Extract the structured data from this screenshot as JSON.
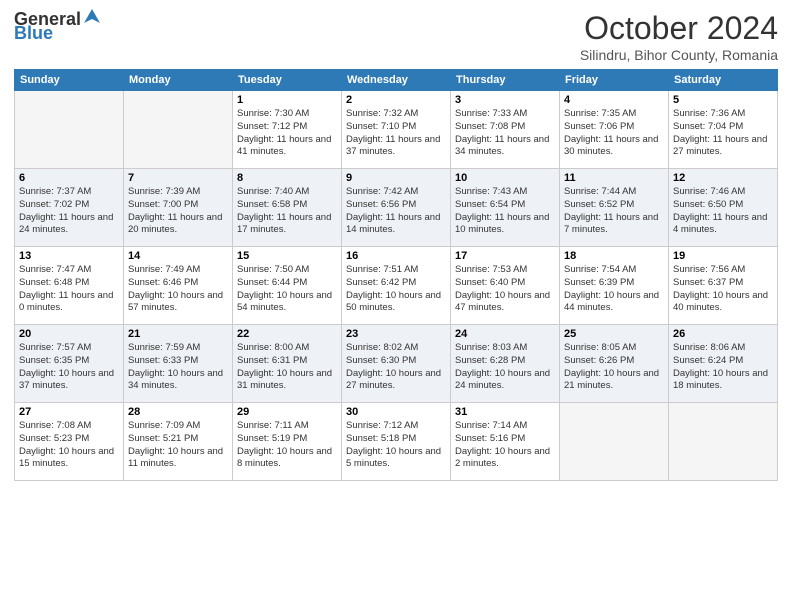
{
  "header": {
    "logo_general": "General",
    "logo_blue": "Blue",
    "month_title": "October 2024",
    "location": "Silindru, Bihor County, Romania"
  },
  "weekdays": [
    "Sunday",
    "Monday",
    "Tuesday",
    "Wednesday",
    "Thursday",
    "Friday",
    "Saturday"
  ],
  "weeks": [
    [
      {
        "day": "",
        "sunrise": "",
        "sunset": "",
        "daylight": ""
      },
      {
        "day": "",
        "sunrise": "",
        "sunset": "",
        "daylight": ""
      },
      {
        "day": "1",
        "sunrise": "Sunrise: 7:30 AM",
        "sunset": "Sunset: 7:12 PM",
        "daylight": "Daylight: 11 hours and 41 minutes."
      },
      {
        "day": "2",
        "sunrise": "Sunrise: 7:32 AM",
        "sunset": "Sunset: 7:10 PM",
        "daylight": "Daylight: 11 hours and 37 minutes."
      },
      {
        "day": "3",
        "sunrise": "Sunrise: 7:33 AM",
        "sunset": "Sunset: 7:08 PM",
        "daylight": "Daylight: 11 hours and 34 minutes."
      },
      {
        "day": "4",
        "sunrise": "Sunrise: 7:35 AM",
        "sunset": "Sunset: 7:06 PM",
        "daylight": "Daylight: 11 hours and 30 minutes."
      },
      {
        "day": "5",
        "sunrise": "Sunrise: 7:36 AM",
        "sunset": "Sunset: 7:04 PM",
        "daylight": "Daylight: 11 hours and 27 minutes."
      }
    ],
    [
      {
        "day": "6",
        "sunrise": "Sunrise: 7:37 AM",
        "sunset": "Sunset: 7:02 PM",
        "daylight": "Daylight: 11 hours and 24 minutes."
      },
      {
        "day": "7",
        "sunrise": "Sunrise: 7:39 AM",
        "sunset": "Sunset: 7:00 PM",
        "daylight": "Daylight: 11 hours and 20 minutes."
      },
      {
        "day": "8",
        "sunrise": "Sunrise: 7:40 AM",
        "sunset": "Sunset: 6:58 PM",
        "daylight": "Daylight: 11 hours and 17 minutes."
      },
      {
        "day": "9",
        "sunrise": "Sunrise: 7:42 AM",
        "sunset": "Sunset: 6:56 PM",
        "daylight": "Daylight: 11 hours and 14 minutes."
      },
      {
        "day": "10",
        "sunrise": "Sunrise: 7:43 AM",
        "sunset": "Sunset: 6:54 PM",
        "daylight": "Daylight: 11 hours and 10 minutes."
      },
      {
        "day": "11",
        "sunrise": "Sunrise: 7:44 AM",
        "sunset": "Sunset: 6:52 PM",
        "daylight": "Daylight: 11 hours and 7 minutes."
      },
      {
        "day": "12",
        "sunrise": "Sunrise: 7:46 AM",
        "sunset": "Sunset: 6:50 PM",
        "daylight": "Daylight: 11 hours and 4 minutes."
      }
    ],
    [
      {
        "day": "13",
        "sunrise": "Sunrise: 7:47 AM",
        "sunset": "Sunset: 6:48 PM",
        "daylight": "Daylight: 11 hours and 0 minutes."
      },
      {
        "day": "14",
        "sunrise": "Sunrise: 7:49 AM",
        "sunset": "Sunset: 6:46 PM",
        "daylight": "Daylight: 10 hours and 57 minutes."
      },
      {
        "day": "15",
        "sunrise": "Sunrise: 7:50 AM",
        "sunset": "Sunset: 6:44 PM",
        "daylight": "Daylight: 10 hours and 54 minutes."
      },
      {
        "day": "16",
        "sunrise": "Sunrise: 7:51 AM",
        "sunset": "Sunset: 6:42 PM",
        "daylight": "Daylight: 10 hours and 50 minutes."
      },
      {
        "day": "17",
        "sunrise": "Sunrise: 7:53 AM",
        "sunset": "Sunset: 6:40 PM",
        "daylight": "Daylight: 10 hours and 47 minutes."
      },
      {
        "day": "18",
        "sunrise": "Sunrise: 7:54 AM",
        "sunset": "Sunset: 6:39 PM",
        "daylight": "Daylight: 10 hours and 44 minutes."
      },
      {
        "day": "19",
        "sunrise": "Sunrise: 7:56 AM",
        "sunset": "Sunset: 6:37 PM",
        "daylight": "Daylight: 10 hours and 40 minutes."
      }
    ],
    [
      {
        "day": "20",
        "sunrise": "Sunrise: 7:57 AM",
        "sunset": "Sunset: 6:35 PM",
        "daylight": "Daylight: 10 hours and 37 minutes."
      },
      {
        "day": "21",
        "sunrise": "Sunrise: 7:59 AM",
        "sunset": "Sunset: 6:33 PM",
        "daylight": "Daylight: 10 hours and 34 minutes."
      },
      {
        "day": "22",
        "sunrise": "Sunrise: 8:00 AM",
        "sunset": "Sunset: 6:31 PM",
        "daylight": "Daylight: 10 hours and 31 minutes."
      },
      {
        "day": "23",
        "sunrise": "Sunrise: 8:02 AM",
        "sunset": "Sunset: 6:30 PM",
        "daylight": "Daylight: 10 hours and 27 minutes."
      },
      {
        "day": "24",
        "sunrise": "Sunrise: 8:03 AM",
        "sunset": "Sunset: 6:28 PM",
        "daylight": "Daylight: 10 hours and 24 minutes."
      },
      {
        "day": "25",
        "sunrise": "Sunrise: 8:05 AM",
        "sunset": "Sunset: 6:26 PM",
        "daylight": "Daylight: 10 hours and 21 minutes."
      },
      {
        "day": "26",
        "sunrise": "Sunrise: 8:06 AM",
        "sunset": "Sunset: 6:24 PM",
        "daylight": "Daylight: 10 hours and 18 minutes."
      }
    ],
    [
      {
        "day": "27",
        "sunrise": "Sunrise: 7:08 AM",
        "sunset": "Sunset: 5:23 PM",
        "daylight": "Daylight: 10 hours and 15 minutes."
      },
      {
        "day": "28",
        "sunrise": "Sunrise: 7:09 AM",
        "sunset": "Sunset: 5:21 PM",
        "daylight": "Daylight: 10 hours and 11 minutes."
      },
      {
        "day": "29",
        "sunrise": "Sunrise: 7:11 AM",
        "sunset": "Sunset: 5:19 PM",
        "daylight": "Daylight: 10 hours and 8 minutes."
      },
      {
        "day": "30",
        "sunrise": "Sunrise: 7:12 AM",
        "sunset": "Sunset: 5:18 PM",
        "daylight": "Daylight: 10 hours and 5 minutes."
      },
      {
        "day": "31",
        "sunrise": "Sunrise: 7:14 AM",
        "sunset": "Sunset: 5:16 PM",
        "daylight": "Daylight: 10 hours and 2 minutes."
      },
      {
        "day": "",
        "sunrise": "",
        "sunset": "",
        "daylight": ""
      },
      {
        "day": "",
        "sunrise": "",
        "sunset": "",
        "daylight": ""
      }
    ]
  ]
}
